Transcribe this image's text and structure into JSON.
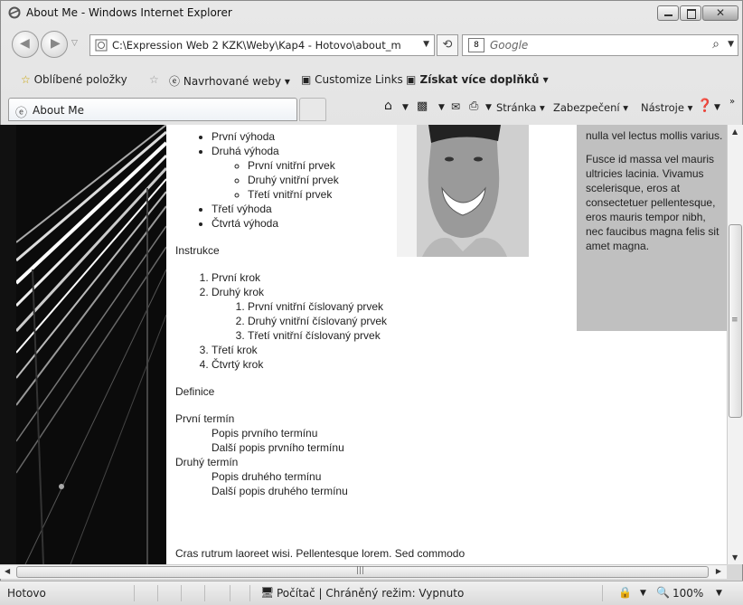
{
  "window": {
    "title": "About Me - Windows Internet Explorer"
  },
  "address": {
    "url": "C:\\Expression Web 2 KZK\\Weby\\Kap4 - Hotovo\\about_m",
    "search_placeholder": "Google"
  },
  "favorites": {
    "label": "Oblíbené položky",
    "items": [
      "Navrhované weby ▾",
      "Customize Links",
      "Získat více doplňků ▾"
    ]
  },
  "tab": {
    "label": "About Me"
  },
  "commandbar": {
    "page": "Stránka ▾",
    "security": "Zabezpečení ▾",
    "tools": "Nástroje ▾"
  },
  "page": {
    "bullets": [
      "První výhoda",
      "Druhá výhoda"
    ],
    "inner_bullets": [
      "První vnitřní prvek",
      "Druhý vnitřní prvek",
      "Třetí vnitřní prvek"
    ],
    "bullets_after": [
      "Třetí výhoda",
      "Čtvrtá výhoda"
    ],
    "heading_instructions": "Instrukce",
    "steps": [
      "První krok",
      "Druhý krok"
    ],
    "inner_steps": [
      "První vnitřní číslovaný prvek",
      "Druhý vnitřní číslovaný prvek",
      "Třetí vnitřní číslovaný prvek"
    ],
    "steps_after": [
      "Třetí krok",
      "Čtvrtý krok"
    ],
    "heading_definitions": "Definice",
    "term1": "První termín",
    "term1_desc": [
      "Popis prvního termínu",
      "Další popis prvního termínu"
    ],
    "term2": "Druhý termín",
    "term2_desc": [
      "Popis druhého termínu",
      "Další popis druhého termínu"
    ],
    "footer_text": "Cras rutrum laoreet wisi. Pellentesque lorem. Sed commodo"
  },
  "sidebar": {
    "p1": "nulla vel lectus mollis varius.",
    "p2": "Fusce id massa vel mauris ultricies lacinia. Vivamus scelerisque, eros at consectetuer pellentesque, eros mauris tempor nibh, nec faucibus magna felis sit amet magna."
  },
  "status": {
    "left": "Hotovo",
    "zone": "Počítač | Chráněný režim: Vypnuto",
    "zoom": "100%"
  }
}
